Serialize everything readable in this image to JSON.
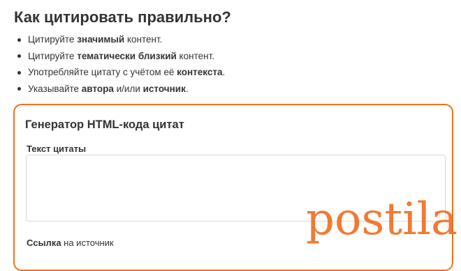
{
  "heading": "Как цитировать правильно?",
  "tips": [
    [
      {
        "t": "Цитируйте ",
        "b": false
      },
      {
        "t": "значимый",
        "b": true
      },
      {
        "t": " контент.",
        "b": false
      }
    ],
    [
      {
        "t": "Цитируйте ",
        "b": false
      },
      {
        "t": "тематически близкий",
        "b": true
      },
      {
        "t": " контент.",
        "b": false
      }
    ],
    [
      {
        "t": "Употребляйте цитату с учётом её ",
        "b": false
      },
      {
        "t": "контекста",
        "b": true
      },
      {
        "t": ".",
        "b": false
      }
    ],
    [
      {
        "t": "Указывайте ",
        "b": false
      },
      {
        "t": "автора",
        "b": true
      },
      {
        "t": " и/или ",
        "b": false
      },
      {
        "t": "источник",
        "b": true
      },
      {
        "t": ".",
        "b": false
      }
    ]
  ],
  "generator": {
    "title": "Генератор HTML-кода цитат",
    "quote_label": "Текст цитаты",
    "quote_value": "",
    "source_label_bold": "Ссылка",
    "source_label_rest": " на источник"
  },
  "watermark": {
    "text": "postila.ru",
    "color": "#f06b1e"
  },
  "colors": {
    "accent_border": "#f0721b",
    "text": "#333333"
  }
}
